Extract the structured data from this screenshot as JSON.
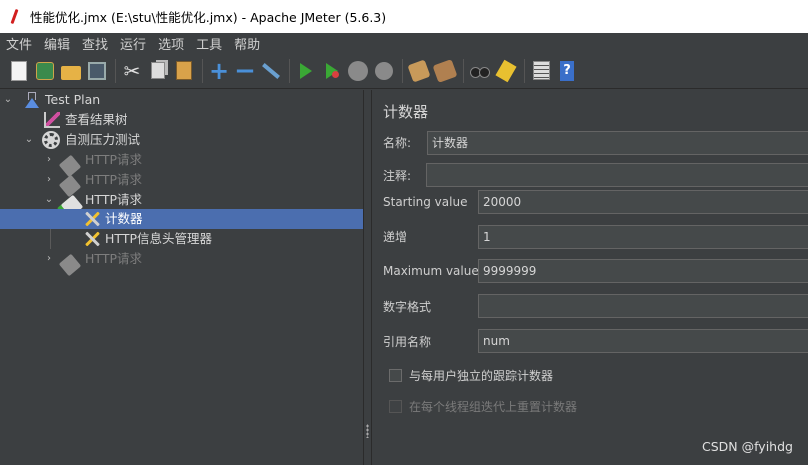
{
  "window": {
    "title": "性能优化.jmx (E:\\stu\\性能优化.jmx) - Apache JMeter (5.6.3)"
  },
  "menu": [
    "文件",
    "编辑",
    "查找",
    "运行",
    "选项",
    "工具",
    "帮助"
  ],
  "toolbar": {
    "icons": [
      "new-icon",
      "templates-icon",
      "open-icon",
      "save-icon",
      "cut-icon",
      "copy-icon",
      "paste-icon",
      "expand-icon",
      "collapse-icon",
      "toggle-icon",
      "start-icon",
      "start-no-pauses-icon",
      "stop-icon",
      "shutdown-icon",
      "clear-icon",
      "clear-all-icon",
      "search-icon",
      "reset-search-icon",
      "function-helper-icon",
      "help-icon"
    ]
  },
  "tree": {
    "nodes": [
      {
        "label": "Test Plan",
        "level": 0,
        "expanded": true,
        "enabled": true,
        "selected": false,
        "icon": "flask-icon"
      },
      {
        "label": "查看结果树",
        "level": 1,
        "expanded": null,
        "enabled": true,
        "selected": false,
        "icon": "results-tree-icon"
      },
      {
        "label": "自测压力测试",
        "level": 1,
        "expanded": true,
        "enabled": true,
        "selected": false,
        "icon": "thread-group-gear-icon"
      },
      {
        "label": "HTTP请求",
        "level": 2,
        "expanded": false,
        "enabled": false,
        "selected": false,
        "icon": "http-sampler-icon"
      },
      {
        "label": "HTTP请求",
        "level": 2,
        "expanded": false,
        "enabled": false,
        "selected": false,
        "icon": "http-sampler-icon"
      },
      {
        "label": "HTTP请求",
        "level": 2,
        "expanded": true,
        "enabled": true,
        "selected": false,
        "icon": "http-sampler-icon"
      },
      {
        "label": "计数器",
        "level": 3,
        "expanded": null,
        "enabled": true,
        "selected": true,
        "icon": "config-element-icon"
      },
      {
        "label": "HTTP信息头管理器",
        "level": 3,
        "expanded": null,
        "enabled": true,
        "selected": false,
        "icon": "config-element-icon"
      },
      {
        "label": "HTTP请求",
        "level": 2,
        "expanded": false,
        "enabled": false,
        "selected": false,
        "icon": "http-sampler-icon"
      }
    ]
  },
  "counter": {
    "panel_title": "计数器",
    "name_label": "名称:",
    "name_value": "计数器",
    "comment_label": "注释:",
    "comment_value": "",
    "start_label": "Starting value",
    "start_value": "20000",
    "increment_label": "递增",
    "increment_value": "1",
    "max_label": "Maximum value",
    "max_value": "9999999",
    "format_label": "数字格式",
    "format_value": "",
    "refname_label": "引用名称",
    "refname_value": "num",
    "per_user_label": "与每用户独立的跟踪计数器",
    "per_user_checked": false,
    "reset_label": "在每个线程组迭代上重置计数器",
    "reset_checked": false,
    "reset_enabled": false
  },
  "watermark": "CSDN @fyihdg",
  "colors": {
    "background": "#3c3f41",
    "selection": "#4b6eaf",
    "field_background": "#45494a",
    "disabled_text": "#7d7d7d"
  }
}
